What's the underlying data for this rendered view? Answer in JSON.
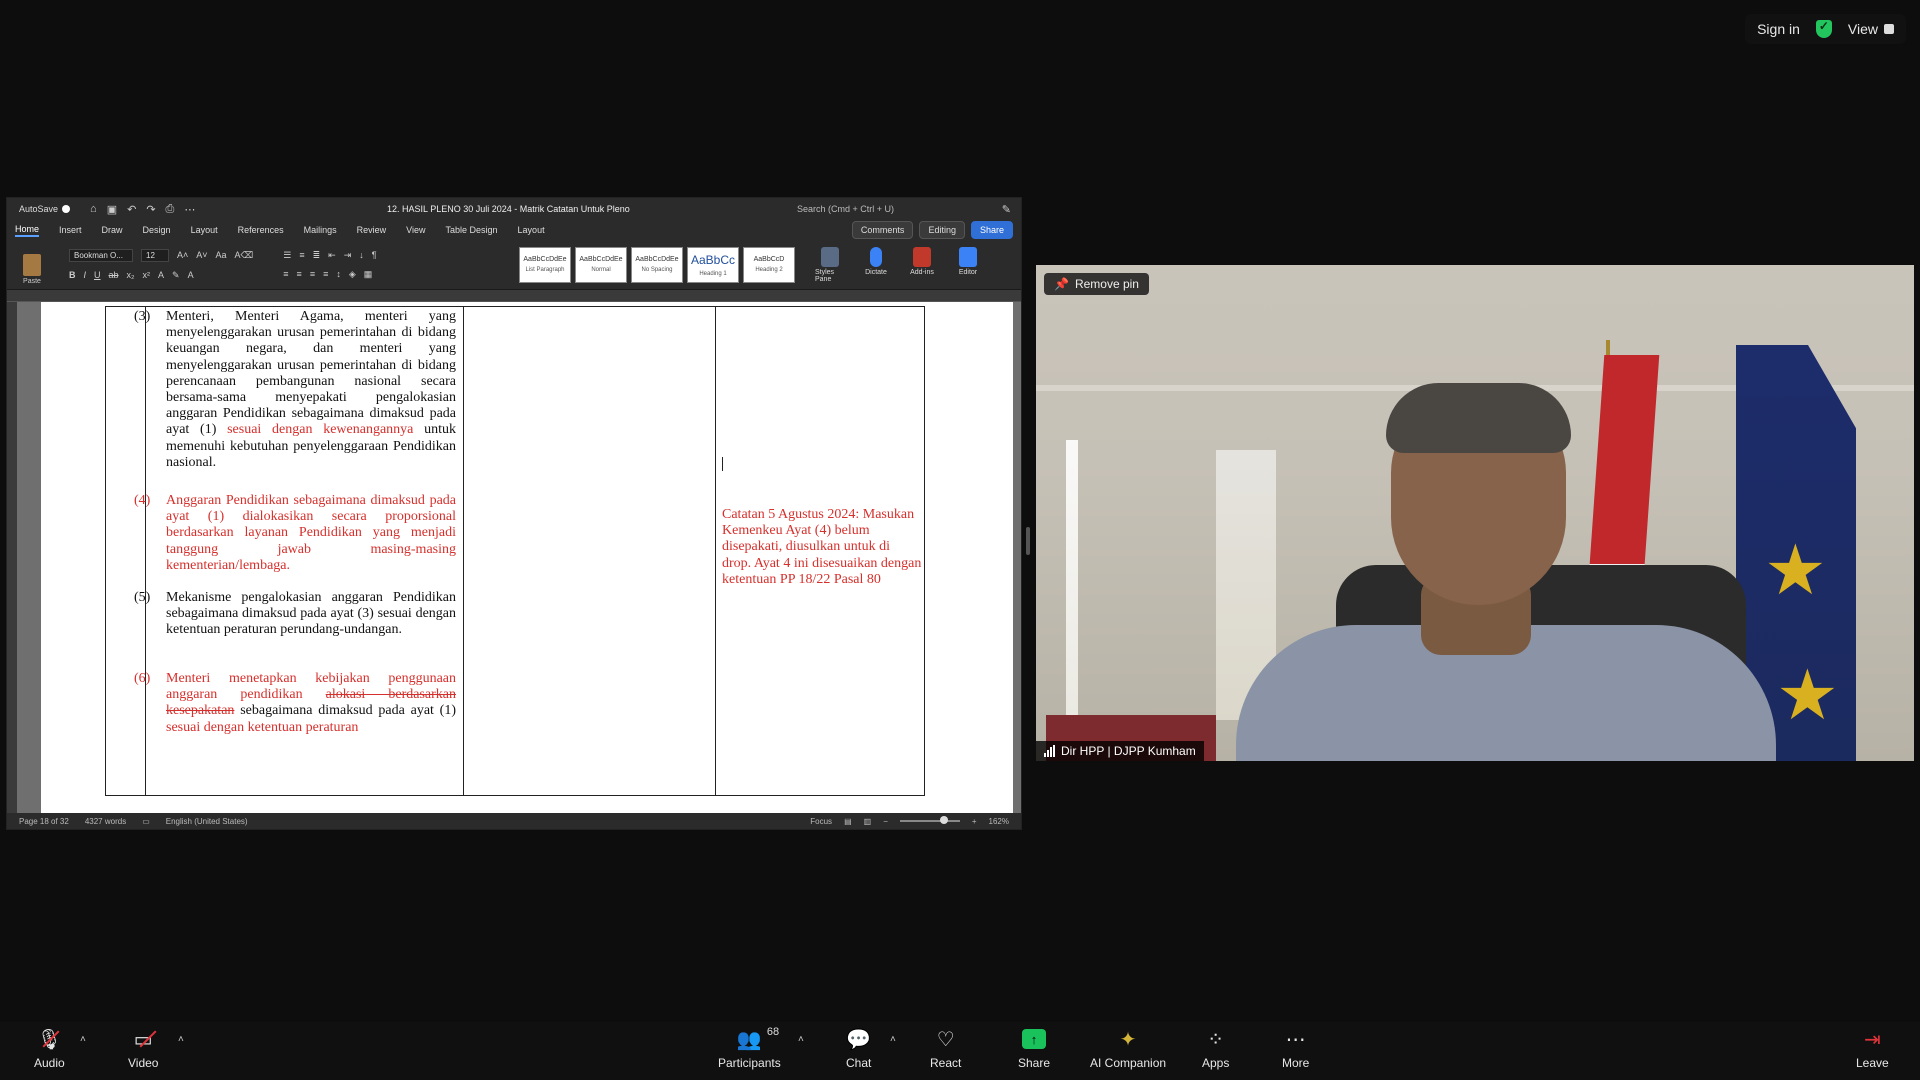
{
  "topbar": {
    "sign_in": "Sign in",
    "view": "View"
  },
  "word": {
    "autosave": "AutoSave",
    "doc_title": "12. HASIL PLENO 30 Juli 2024 - Matrik Catatan Untuk Pleno",
    "search_placeholder": "Search (Cmd + Ctrl + U)",
    "tabs": [
      "Home",
      "Insert",
      "Draw",
      "Design",
      "Layout",
      "References",
      "Mailings",
      "Review",
      "View",
      "Table Design",
      "Layout"
    ],
    "comments": "Comments",
    "editing": "Editing",
    "share": "Share",
    "paste": "Paste",
    "font_name": "Bookman O...",
    "font_size": "12",
    "styles": [
      {
        "sample": "AaBbCcDdEe",
        "name": "List Paragraph"
      },
      {
        "sample": "AaBbCcDdEe",
        "name": "Normal"
      },
      {
        "sample": "AaBbCcDdEe",
        "name": "No Spacing"
      },
      {
        "sample": "AaBbCc",
        "name": "Heading 1"
      },
      {
        "sample": "AaBbCcD",
        "name": "Heading 2"
      }
    ],
    "tools": [
      "Styles Pane",
      "Dictate",
      "Add-ins",
      "Editor"
    ],
    "items": {
      "n3": "(3)",
      "t3a": "Menteri, Menteri Agama, menteri yang menyelenggarakan urusan pemerintahan di bidang keuangan negara, dan menteri yang menyelenggarakan urusan pemerintahan di bidang perencanaan pembangunan nasional secara bersama-sama menyepakati pengalokasian anggaran Pendidikan sebagaimana dimaksud pada ayat (1)",
      "t3red": "sesuai dengan kewenangannya",
      "t3b": "untuk memenuhi kebutuhan penyelenggaraan Pendidikan nasional.",
      "n4": "(4)",
      "t4": "Anggaran Pendidikan sebagaimana dimaksud pada ayat (1) dialokasikan secara proporsional berdasarkan layanan Pendidikan yang menjadi tanggung jawab masing-masing kementerian/lembaga.",
      "n5": "(5)",
      "t5": "Mekanisme pengalokasian anggaran Pendidikan sebagaimana dimaksud pada ayat (3) sesuai dengan ketentuan peraturan perundang-undangan.",
      "n6": "(6)",
      "t6a": "Menteri menetapkan kebijakan penggunaan anggaran pendidikan",
      "t6strike": "alokasi berdasarkan kesepakatan",
      "t6b": "sebagaimana dimaksud pada ayat (1)",
      "t6c": "sesuai dengan ketentuan peraturan"
    },
    "note": "Catatan 5 Agustus 2024: Masukan Kemenkeu Ayat (4) belum disepakati, diusulkan untuk di drop. Ayat 4 ini disesuaikan dengan ketentuan PP 18/22 Pasal 80",
    "status": {
      "page": "Page 18 of 32",
      "words": "4327 words",
      "language": "English (United States)",
      "focus": "Focus",
      "zoom": "162%"
    }
  },
  "video": {
    "pin_label": "Remove pin",
    "participant_name": "Dir HPP | DJPP Kumham"
  },
  "toolbar": {
    "audio": "Audio",
    "video": "Video",
    "participants": "Participants",
    "participant_count": "68",
    "chat": "Chat",
    "react": "React",
    "share": "Share",
    "ai_companion": "AI Companion",
    "apps": "Apps",
    "more": "More",
    "leave": "Leave"
  },
  "colors": {
    "accent_green": "#19c25a",
    "redline": "#d6302c",
    "share_blue": "#2f6fd6"
  }
}
